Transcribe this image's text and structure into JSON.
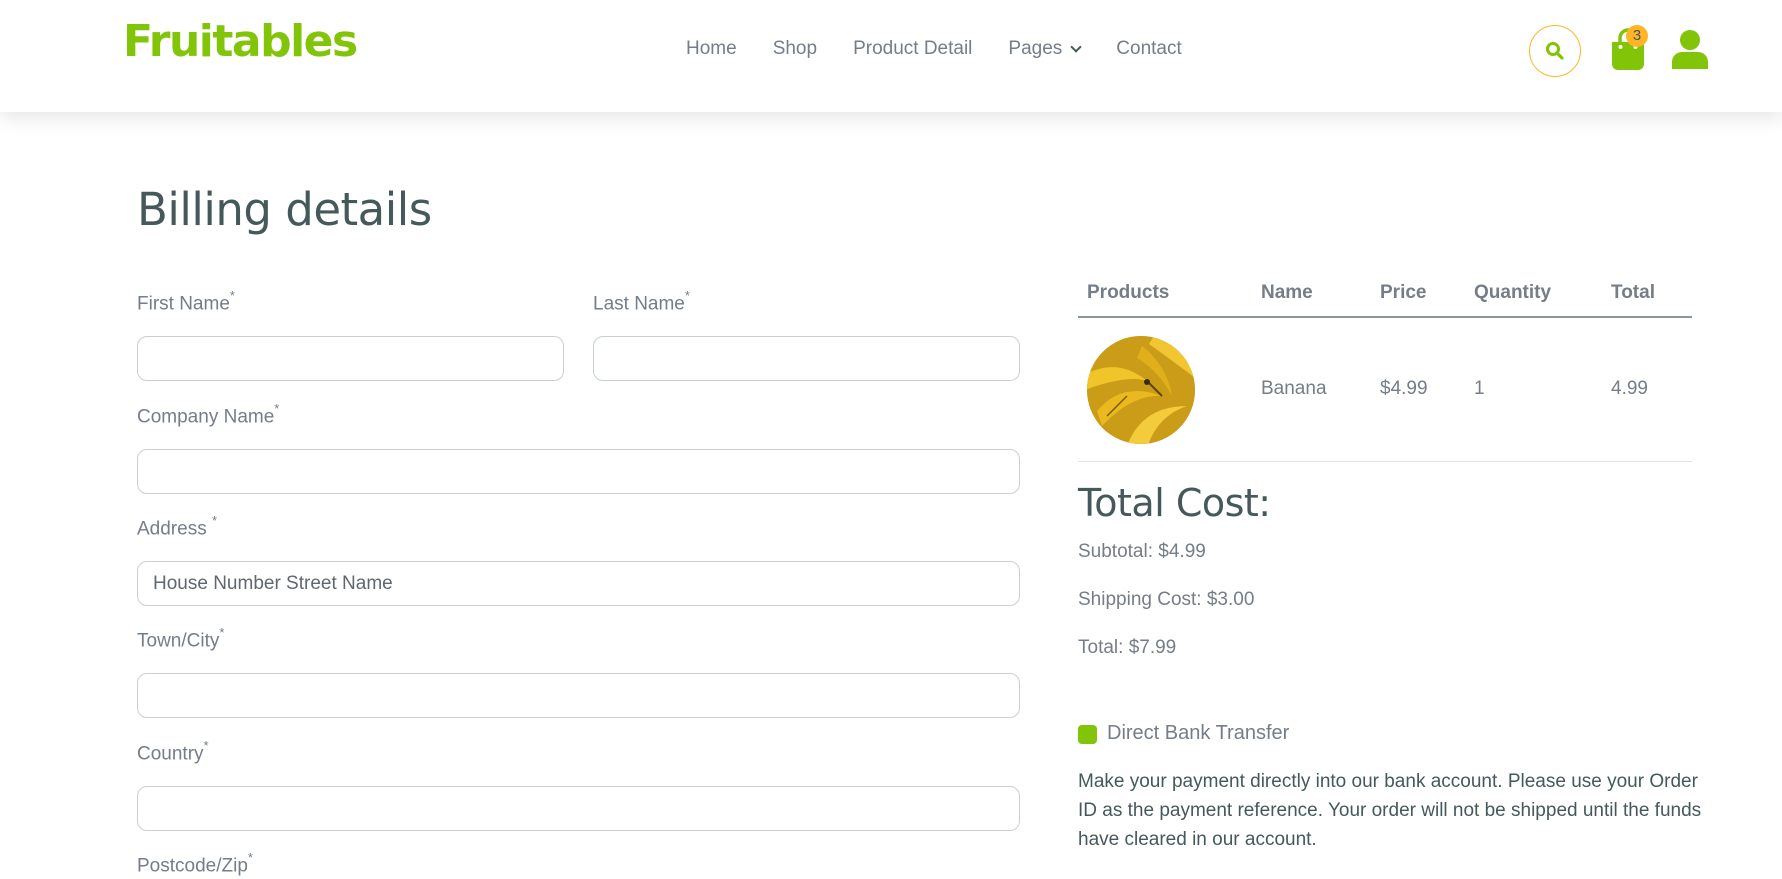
{
  "header": {
    "brand": "Fruitables",
    "nav": [
      "Home",
      "Shop",
      "Product Detail",
      "Pages",
      "Contact"
    ],
    "cart_count": "3",
    "colors": {
      "brand": "#81c408",
      "accent": "#ffb524",
      "heading": "#45595b",
      "text": "#747d88"
    }
  },
  "billing": {
    "title": "Billing details",
    "required_mark": "*",
    "fields": {
      "first_name": {
        "label": "First Name",
        "value": "",
        "placeholder": ""
      },
      "last_name": {
        "label": "Last Name",
        "value": "",
        "placeholder": ""
      },
      "company": {
        "label": "Company Name",
        "value": "",
        "placeholder": ""
      },
      "address": {
        "label": "Address ",
        "value": "",
        "placeholder": "House Number Street Name"
      },
      "town": {
        "label": "Town/City",
        "value": "",
        "placeholder": ""
      },
      "country": {
        "label": "Country",
        "value": "",
        "placeholder": ""
      },
      "postcode": {
        "label": "Postcode/Zip",
        "value": "",
        "placeholder": ""
      }
    }
  },
  "order": {
    "columns": [
      "Products",
      "Name",
      "Price",
      "Quantity",
      "Total"
    ],
    "items": [
      {
        "image": "banana-image",
        "name": "Banana",
        "price": "$4.99",
        "quantity": "1",
        "total": "4.99"
      }
    ],
    "total_title": "Total Cost:",
    "subtotal": "Subtotal: $4.99",
    "shipping": "Shipping Cost: $3.00",
    "total": "Total: $7.99"
  },
  "payment": {
    "method": "Direct Bank Transfer",
    "checked": true,
    "description": "Make your payment directly into our bank account. Please use your Order ID as the payment reference. Your order will not be shipped until the funds have cleared in our account."
  }
}
